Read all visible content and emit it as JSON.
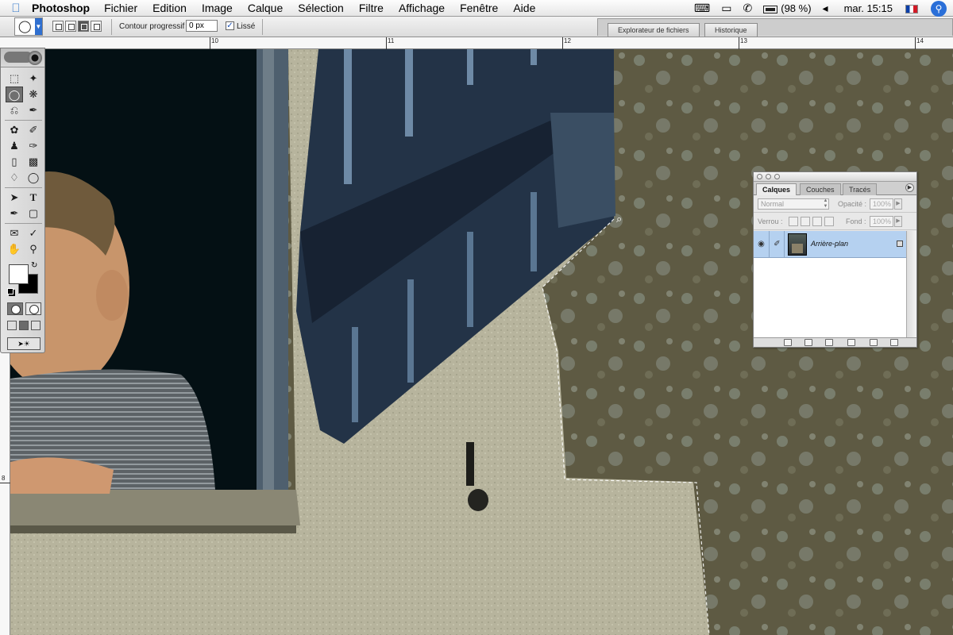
{
  "menubar": {
    "app_name": "Photoshop",
    "menus": [
      "Fichier",
      "Edition",
      "Image",
      "Calque",
      "Sélection",
      "Filtre",
      "Affichage",
      "Fenêtre",
      "Aide"
    ],
    "battery": "(98 %)",
    "clock": "mar. 15:15"
  },
  "options": {
    "feather_label": "Contour progressif :",
    "feather_value": "0 px",
    "smooth_label": "Lissé",
    "smooth_checked": true,
    "well_tabs": [
      "Explorateur de fichiers",
      "Historique"
    ]
  },
  "rulers": {
    "h_labels": [
      "10",
      "11",
      "12",
      "13",
      "14"
    ],
    "v_labels": [
      "8"
    ]
  },
  "toolbox": {
    "active_tool": "lasso-polygonal"
  },
  "layers": {
    "tabs": [
      "Calques",
      "Couches",
      "Tracés"
    ],
    "active_tab": "Calques",
    "blend_mode": "Normal",
    "opacity_label": "Opacité :",
    "opacity_value": "100%",
    "lock_label": "Verrou :",
    "fill_label": "Fond :",
    "fill_value": "100%",
    "items": [
      {
        "name": "Arrière-plan",
        "visible": true,
        "locked": true,
        "selected": true
      }
    ]
  },
  "colors": {
    "foreground": "#ffffff",
    "background": "#000000",
    "selection_highlight": "#b5d1f0"
  }
}
